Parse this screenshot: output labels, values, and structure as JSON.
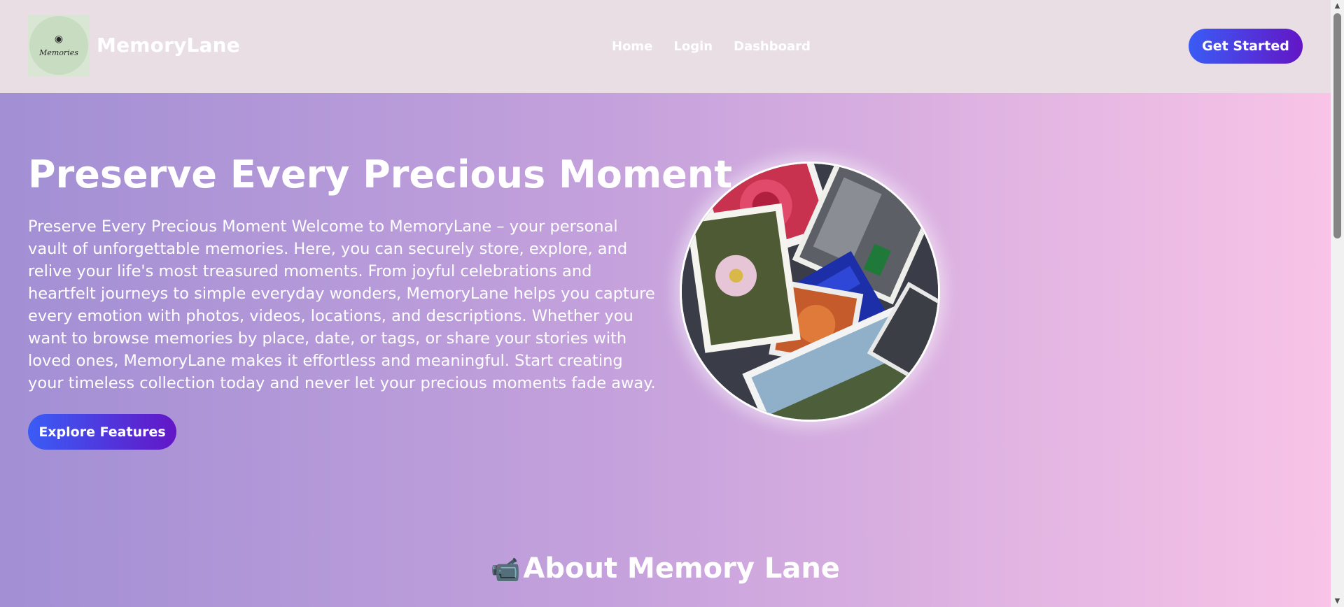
{
  "brand": {
    "name": "MemoryLane",
    "logo_text": "Memories",
    "logo_icon": "camera-icon"
  },
  "nav": {
    "items": [
      {
        "label": "Home"
      },
      {
        "label": "Login"
      },
      {
        "label": "Dashboard"
      }
    ],
    "cta_label": "Get Started"
  },
  "hero": {
    "title": "Preserve Every Precious Moment",
    "description": "Preserve Every Precious Moment Welcome to MemoryLane – your personal vault of unforgettable memories. Here, you can securely store, explore, and relive your life's most treasured moments. From joyful celebrations and heartfelt journeys to simple everyday wonders, MemoryLane helps you capture every emotion with photos, videos, locations, and descriptions. Whether you want to browse memories by place, date, or tags, or share your stories with loved ones, MemoryLane makes it effortless and meaningful. Start creating your timeless collection today and never let your precious moments fade away.",
    "button_label": "Explore Features",
    "image_icon": "photo-collage-image"
  },
  "about": {
    "icon": "video-camera-icon",
    "title": "About Memory Lane"
  },
  "colors": {
    "header_bg": "#e8dee3",
    "gradient_start": "#a28fd4",
    "gradient_end": "#f9c4e7",
    "button_start": "#3a5cf5",
    "button_end": "#6316c6"
  }
}
